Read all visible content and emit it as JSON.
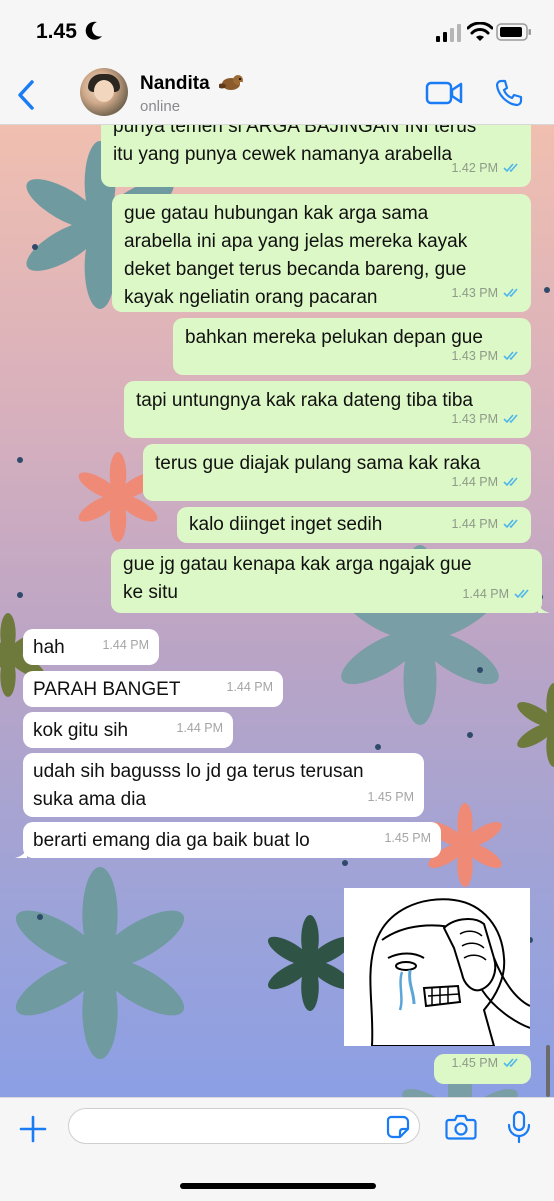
{
  "status_bar": {
    "time": "1.45"
  },
  "header": {
    "contact_name": "Nandita",
    "contact_status": "online"
  },
  "messages": [
    {
      "from": "me",
      "lines": [
        "punya temen si ARGA BAJINGAN INI terus",
        "itu yang punya cewek namanya arabella"
      ],
      "time": "1.42 PM"
    },
    {
      "from": "me",
      "lines": [
        "gue gatau hubungan kak arga sama",
        "arabella ini apa yang jelas mereka kayak",
        "deket banget terus becanda bareng, gue",
        "kayak ngeliatin orang pacaran"
      ],
      "time": "1.43 PM"
    },
    {
      "from": "me",
      "lines": [
        "bahkan mereka pelukan depan gue"
      ],
      "time": "1.43 PM"
    },
    {
      "from": "me",
      "lines": [
        "tapi untungnya kak raka dateng tiba tiba"
      ],
      "time": "1.43 PM"
    },
    {
      "from": "me",
      "lines": [
        "terus gue diajak pulang sama kak raka"
      ],
      "time": "1.44 PM"
    },
    {
      "from": "me",
      "lines": [
        "kalo diinget inget sedih"
      ],
      "time": "1.44 PM"
    },
    {
      "from": "me",
      "lines": [
        "gue jg gatau kenapa kak arga ngajak gue",
        "ke situ"
      ],
      "time": "1.44 PM"
    },
    {
      "from": "them",
      "lines": [
        "hah"
      ],
      "time": "1.44 PM"
    },
    {
      "from": "them",
      "lines": [
        "PARAH BANGET"
      ],
      "time": "1.44 PM"
    },
    {
      "from": "them",
      "lines": [
        "kok gitu sih"
      ],
      "time": "1.44 PM"
    },
    {
      "from": "them",
      "lines": [
        "udah sih bagusss lo jd ga terus terusan",
        "suka ama dia"
      ],
      "time": "1.45 PM"
    },
    {
      "from": "them",
      "lines": [
        "berarti emang dia ga baik buat lo"
      ],
      "time": "1.45 PM"
    },
    {
      "from": "me",
      "type": "sticker",
      "sticker": "crying-wojak-sticker",
      "time": "1.45 PM"
    }
  ],
  "input_bar": {
    "placeholder": ""
  },
  "icons": {
    "back": "chevron-left-icon",
    "video": "video-camera-icon",
    "call": "phone-icon",
    "add": "plus-icon",
    "sticker": "sticker-icon",
    "camera": "camera-icon",
    "mic": "microphone-icon"
  },
  "colors": {
    "accent": "#1a7cf4",
    "outgoing_bubble": "#dcf8c6",
    "incoming_bubble": "#ffffff",
    "read_ticks": "#4fb6ec"
  }
}
